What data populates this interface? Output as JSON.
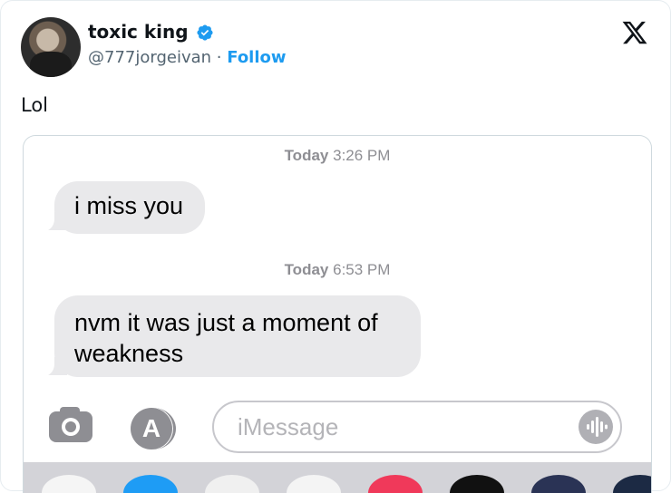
{
  "tweet": {
    "display_name": "toxic king",
    "handle": "@777jorgeivan",
    "separator": "·",
    "follow_label": "Follow",
    "text": "Lol"
  },
  "screenshot": {
    "timestamps": [
      {
        "day": "Today",
        "time": "3:26 PM"
      },
      {
        "day": "Today",
        "time": "6:53 PM"
      }
    ],
    "messages": [
      {
        "text": "i miss you"
      },
      {
        "line1": "nvm it was just a moment of",
        "line2": "weakness"
      }
    ],
    "input_placeholder": "iMessage"
  },
  "icons": [
    "verified-badge-icon",
    "x-logo-icon",
    "camera-icon",
    "app-store-icon",
    "audio-waveform-icon"
  ],
  "colors": {
    "follow": "#1d9bf0",
    "bubble": "#e9e9eb",
    "timestamp": "#8e8e93"
  }
}
